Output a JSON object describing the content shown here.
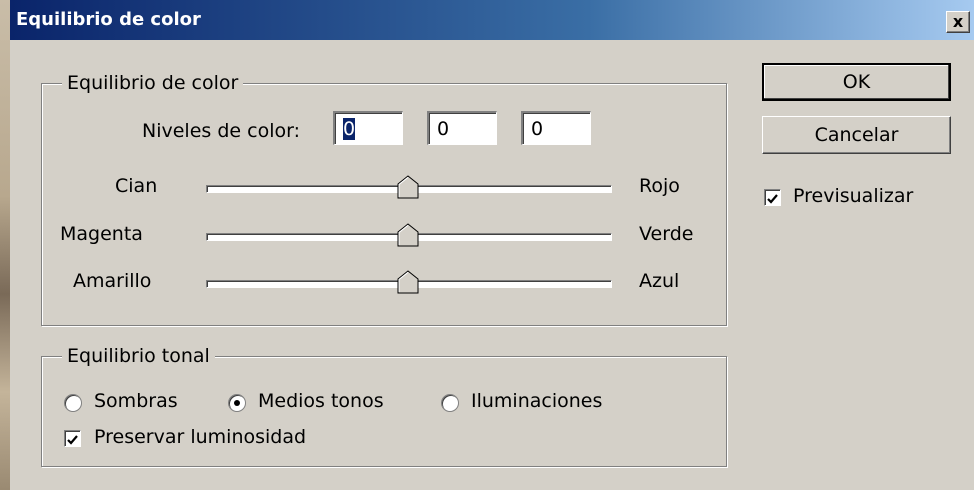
{
  "window": {
    "title": "Equilibrio de color",
    "close_symbol": "x"
  },
  "color_balance_group": {
    "legend": "Equilibrio de color",
    "levels_label": "Niveles de color:",
    "levels": [
      "0",
      "0",
      "0"
    ],
    "sliders": [
      {
        "left": "Cian",
        "right": "Rojo",
        "value": 0
      },
      {
        "left": "Magenta",
        "right": "Verde",
        "value": 0
      },
      {
        "left": "Amarillo",
        "right": "Azul",
        "value": 0
      }
    ]
  },
  "tonal_group": {
    "legend": "Equilibrio tonal",
    "options": [
      "Sombras",
      "Medios tonos",
      "Iluminaciones"
    ],
    "selected": "Medios tonos",
    "preserve_label": "Preservar luminosidad",
    "preserve_checked": true
  },
  "buttons": {
    "ok": "OK",
    "cancel": "Cancelar"
  },
  "preview": {
    "label": "Previsualizar",
    "checked": true
  }
}
